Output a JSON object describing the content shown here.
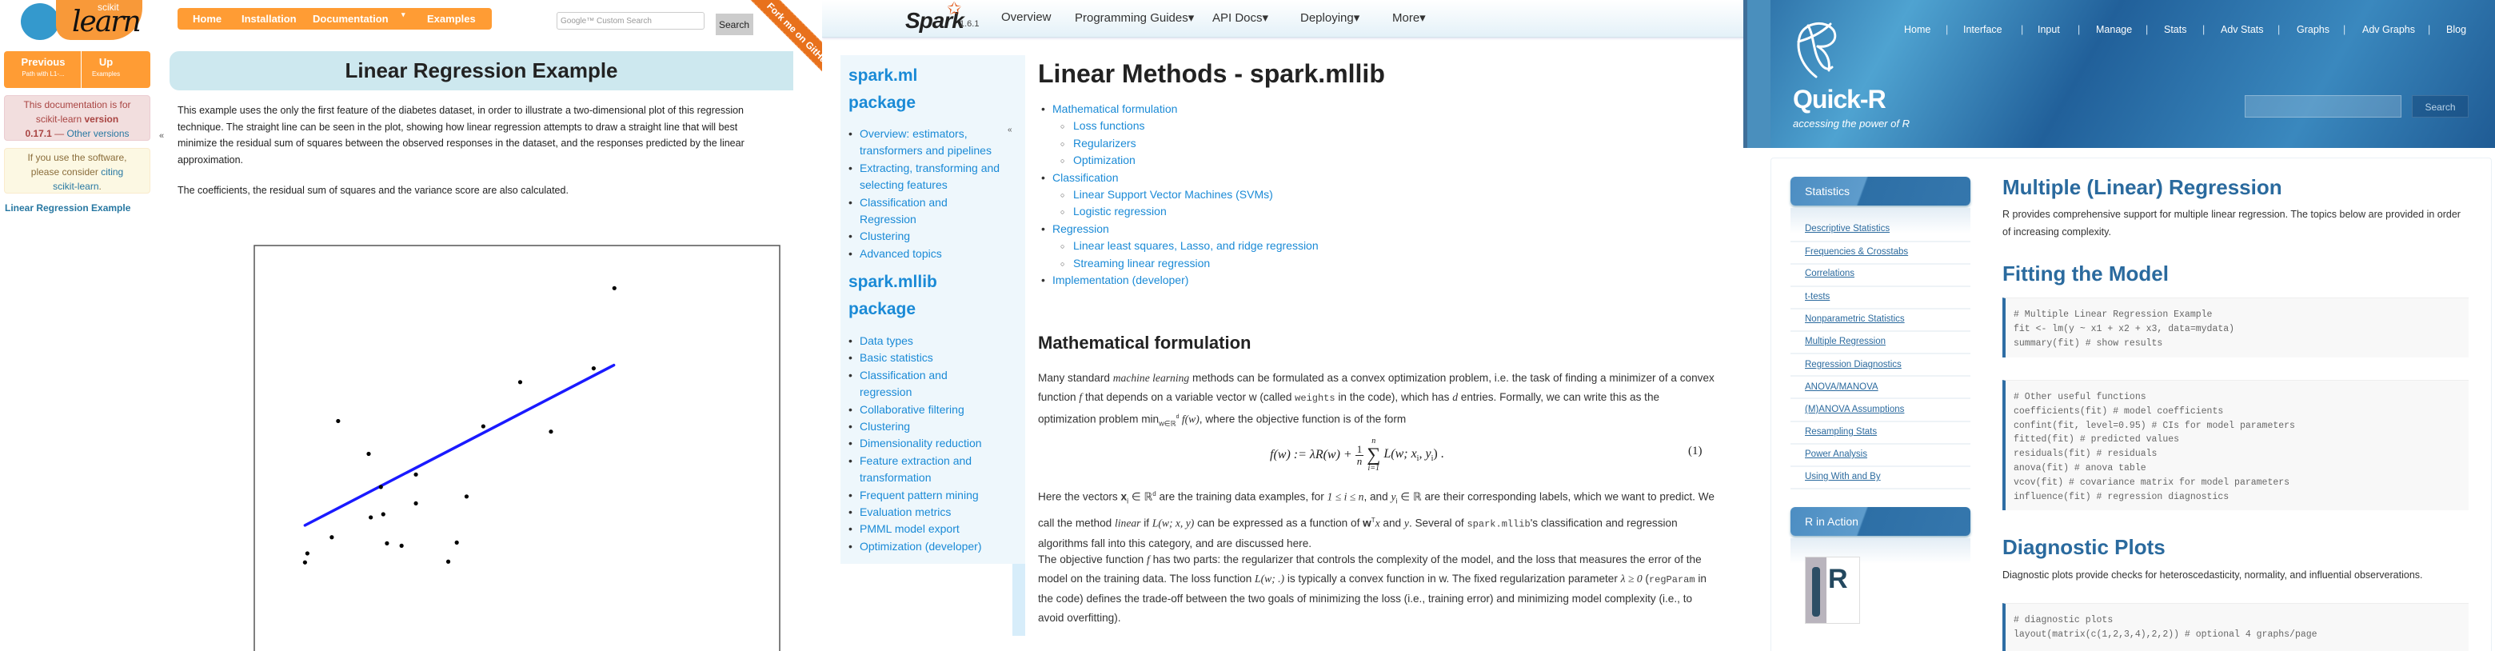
{
  "sklearn": {
    "logo_small": "scikit",
    "logo_big": "learn",
    "nav": [
      "Home",
      "Installation",
      "Documentation",
      "Examples"
    ],
    "nav_dropdown_glyph": "▾",
    "search_placeholder": "Google™ Custom Search",
    "search_button": "Search",
    "ribbon": "Fork me on GitHub",
    "prev_label": "Previous",
    "prev_sub": "Path with L1-...",
    "up_label": "Up",
    "up_sub": "Examples",
    "warning": {
      "t1": "This documentation is for",
      "t2": "scikit-learn ",
      "version_word": "version",
      "version": "0.17.1",
      "dash": " — ",
      "other": "Other versions"
    },
    "cite": {
      "t1": "If you use the software,",
      "t2": "please consider ",
      "citing": "citing",
      "t3": "scikit-learn",
      "t4": "."
    },
    "sidebar_link": "Linear Regression Example",
    "collapse_glyph": "«",
    "title": "Linear Regression Example",
    "paragraph1": "This example uses the only the first feature of the diabetes dataset, in order to illustrate a two-dimensional plot of this regression technique. The straight line can be seen in the plot, showing how linear regression attempts to draw a straight line that will best minimize the residual sum of squares between the observed responses in the dataset, and the responses predicted by the linear approximation.",
    "paragraph2": "The coefficients, the residual sum of squares and the variance score are also calculated.",
    "colors": {
      "orange": "#ff9c34",
      "banner": "#cde8ef",
      "link": "#2878a2",
      "line": "#1a1aff"
    }
  },
  "chart_data": {
    "type": "scatter",
    "title": "",
    "xlabel": "",
    "ylabel": "",
    "ticks": "none",
    "grid": false,
    "xlim": [
      5,
      203
    ],
    "ylim": [
      -30,
      128
    ],
    "points": [
      [
        140.7,
        111.9
      ],
      [
        132.9,
        81.6
      ],
      [
        105.2,
        76.4
      ],
      [
        91.3,
        59.7
      ],
      [
        116.8,
        57.7
      ],
      [
        36.6,
        61.7
      ],
      [
        48.1,
        49.3
      ],
      [
        65.9,
        41.5
      ],
      [
        52.7,
        36.8
      ],
      [
        85.0,
        33.2
      ],
      [
        65.9,
        30.6
      ],
      [
        53.6,
        26.5
      ],
      [
        48.9,
        25.3
      ],
      [
        34.2,
        17.8
      ],
      [
        25.0,
        11.7
      ],
      [
        24.1,
        8.3
      ],
      [
        55.0,
        15.5
      ],
      [
        60.5,
        14.6
      ],
      [
        81.3,
        15.8
      ],
      [
        78.1,
        8.6
      ]
    ],
    "point_color": "#000000",
    "fit_line": {
      "from": [
        24.1,
        22.3
      ],
      "to": [
        140.5,
        82.8
      ],
      "color": "#1a1aff"
    }
  },
  "spark": {
    "logo": "Spark",
    "version": "1.6.1",
    "nav": [
      "Overview",
      "Programming Guides▾",
      "API Docs▾",
      "Deploying▾",
      "More▾"
    ],
    "sidebar": {
      "ml_title": "spark.ml",
      "ml_title2": "package",
      "ml_items": [
        "Overview: estimators, transformers and pipelines",
        "Extracting, transforming and selecting features",
        "Classification and Regression",
        "Clustering",
        "Advanced topics"
      ],
      "mllib_title": "spark.mllib",
      "mllib_title2": "package",
      "mllib_items": [
        "Data types",
        "Basic statistics",
        "Classification and regression",
        "Collaborative filtering",
        "Clustering",
        "Dimensionality reduction",
        "Feature extraction and transformation",
        "Frequent pattern mining",
        "Evaluation metrics",
        "PMML model export",
        "Optimization (developer)"
      ]
    },
    "collapse_glyph": "«",
    "title": "Linear Methods - spark.mllib",
    "toc": [
      {
        "label": "Mathematical formulation",
        "level": 1
      },
      {
        "label": "Loss functions",
        "level": 2
      },
      {
        "label": "Regularizers",
        "level": 2
      },
      {
        "label": "Optimization",
        "level": 2
      },
      {
        "label": "Classification",
        "level": 1
      },
      {
        "label": "Linear Support Vector Machines (SVMs)",
        "level": 2
      },
      {
        "label": "Logistic regression",
        "level": 2
      },
      {
        "label": "Regression",
        "level": 1
      },
      {
        "label": "Linear least squares, Lasso, and ridge regression",
        "level": 2
      },
      {
        "label": "Streaming linear regression",
        "level": 2
      },
      {
        "label": "Implementation (developer)",
        "level": 1
      }
    ],
    "section_title": "Mathematical formulation",
    "p1": {
      "a": "Many standard ",
      "b": "machine learning",
      "c": " methods can be formulated as a convex optimization problem, i.e. the task of finding a minimizer of a convex function ",
      "d": "f",
      "e": " that depends on a variable vector w (called ",
      "f": "weights",
      "g": " in the code), which has ",
      "h": "d",
      "i": " entries. Formally, we can write this as the optimization problem ",
      "j": "min",
      "k": "w∈ℝ",
      "l": "d",
      "m": " f(w)",
      "n": ", where the objective function is of the form"
    },
    "formula": {
      "lhs": "f(w) := λR(w) +",
      "num": "1",
      "den": "n",
      "sum_top": "n",
      "sum": "∑",
      "sum_bot": "i=1",
      "rhs": "L(w; x",
      "sub_i": "i",
      "comma": ", y",
      "sub_i2": "i",
      "end": ") .",
      "eqno": "(1)"
    },
    "p2": {
      "a": "Here the vectors ",
      "b": "x",
      "c": "i",
      "d": " ∈ ℝ",
      "e": "d",
      "f": " are the training data examples, for ",
      "g": "1 ≤ i ≤ n",
      "h": ", and ",
      "i": "y",
      "j": "i",
      "k": " ∈ ℝ",
      "l": " are their corresponding labels, which we want to predict. We call the method ",
      "m": "linear",
      "n": " if ",
      "o": "L(w; x, y)",
      "p": " can be expressed as a function of ",
      "q": "w",
      "r": "T",
      "s": "x",
      "t": " and ",
      "u": "y",
      "v": ". Several of ",
      "w": "spark.mllib",
      "x": "'s classification and regression algorithms fall into this category, and are discussed here."
    },
    "p3": {
      "a": "The objective function ",
      "b": "f",
      "c": " has two parts: the regularizer that controls the complexity of the model, and the loss that measures the error of the model on the training data. The loss function ",
      "d": "L(w; .)",
      "e": " is typically a convex function in w. The fixed regularization parameter ",
      "f": "λ ≥ 0",
      "g": " (",
      "h": "regParam",
      "i": " in the code) defines the trade-off between the two goals of minimizing the loss (i.e., training error) and minimizing model complexity (i.e., to avoid overfitting)."
    },
    "colors": {
      "link": "#1a8ad6",
      "sidebar": "#eef7fc",
      "star": "#e25a1c"
    }
  },
  "quickr": {
    "title": "Quick-R",
    "tagline": "accessing the power of R",
    "nav": [
      "Home",
      "Interface",
      "Input",
      "Manage",
      "Stats",
      "Adv Stats",
      "Graphs",
      "Adv Graphs",
      "Blog"
    ],
    "nav_sep": "|",
    "search_value": "",
    "search_button": "Search",
    "sidebar_heading": "Statistics",
    "sidebar_links": [
      "Descriptive Statistics",
      "Frequencies & Crosstabs",
      "Correlations",
      "t-tests",
      "Nonparametric Statistics",
      "Multiple Regression",
      "Regression Diagnostics",
      "ANOVA/MANOVA",
      "(M)ANOVA Assumptions",
      "Resampling Stats",
      "Power Analysis",
      "Using With and By"
    ],
    "book_heading": "R in Action",
    "book_cover_letter": "R",
    "page_title": "Multiple (Linear) Regression",
    "intro": "R provides comprehensive support for multiple linear regression. The topics below are provided in order of increasing complexity.",
    "section1": "Fitting the Model",
    "code1": "# Multiple Linear Regression Example\nfit <- lm(y ~ x1 + x2 + x3, data=mydata)\nsummary(fit) # show results",
    "code2": "# Other useful functions\ncoefficients(fit) # model coefficients\nconfint(fit, level=0.95) # CIs for model parameters\nfitted(fit) # predicted values\nresiduals(fit) # residuals\nanova(fit) # anova table\nvcov(fit) # covariance matrix for model parameters\ninfluence(fit) # regression diagnostics",
    "section2": "Diagnostic Plots",
    "diag_text": "Diagnostic plots provide checks for heteroscedasticity, normality, and influential observerations.",
    "code3": "# diagnostic plots\nlayout(matrix(c(1,2,3,4),2,2)) # optional 4 graphs/page",
    "colors": {
      "header": "#2b6ea5",
      "heading": "#2a6a9e",
      "code_border": "#2e6da4"
    }
  }
}
